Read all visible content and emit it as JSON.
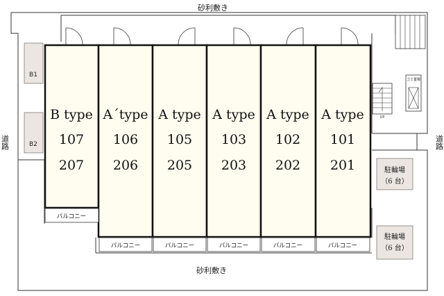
{
  "surroundings": {
    "gravel_top": "砂利敷き",
    "gravel_bottom": "砂利敷き",
    "road_left": "道路",
    "road_right": "道路"
  },
  "parking": [
    {
      "label": "B1"
    },
    {
      "label": "B2"
    }
  ],
  "units": [
    {
      "type": "B type",
      "upper": "107",
      "lower": "207",
      "balcony": "バルコニー"
    },
    {
      "type": "A´type",
      "upper": "106",
      "lower": "206",
      "balcony": "バルコニー"
    },
    {
      "type": "A type",
      "upper": "105",
      "lower": "205",
      "balcony": "バルコニー"
    },
    {
      "type": "A type",
      "upper": "103",
      "lower": "203",
      "balcony": "バルコニー"
    },
    {
      "type": "A type",
      "upper": "102",
      "lower": "202",
      "balcony": "バルコニー"
    },
    {
      "type": "A type",
      "upper": "101",
      "lower": "201",
      "balcony": "バルコニー"
    }
  ],
  "garbage": {
    "label": "ゴミ置場"
  },
  "stairs": {
    "label": "UP"
  },
  "bike_parking": [
    {
      "line1": "駐輪場",
      "line2": "（6 台）"
    },
    {
      "line1": "駐輪場",
      "line2": "（6 台）"
    }
  ],
  "colors": {
    "unit_fill": "#fffdf0",
    "parking_fill": "#ebe6e1",
    "bike_fill": "#ebe6e1",
    "line": "#111111"
  }
}
